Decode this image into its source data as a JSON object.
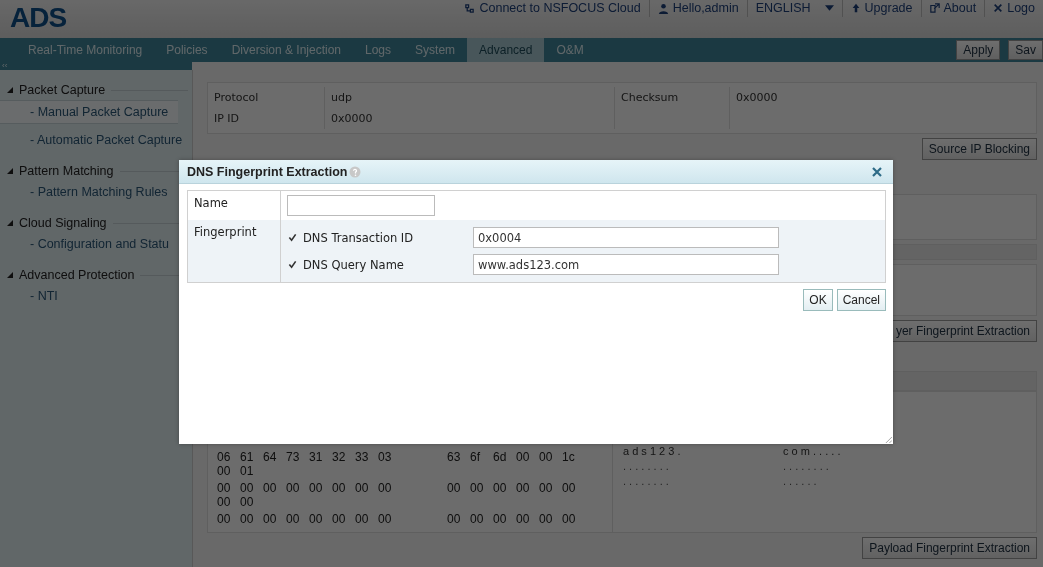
{
  "header": {
    "logo": "ADS",
    "links": [
      {
        "label": "Connect to NSFOCUS Cloud",
        "kind": "link"
      },
      {
        "label": "Hello,admin",
        "kind": "link"
      },
      {
        "label": "ENGLISH",
        "kind": "dropdown"
      },
      {
        "label": "Upgrade",
        "kind": "link"
      },
      {
        "label": "About",
        "kind": "link"
      },
      {
        "label": "Logo",
        "kind": "link"
      }
    ]
  },
  "nav": {
    "tabs": [
      {
        "label": "Real-Time Monitoring",
        "selected": false
      },
      {
        "label": "Policies",
        "selected": false
      },
      {
        "label": "Diversion & Injection",
        "selected": false
      },
      {
        "label": "Logs",
        "selected": false
      },
      {
        "label": "System",
        "selected": false
      },
      {
        "label": "Advanced",
        "selected": true
      },
      {
        "label": "O&M",
        "selected": false
      }
    ],
    "actions": [
      "Apply",
      "Sav"
    ]
  },
  "sidebar": {
    "collapse": "‹‹",
    "groups": [
      {
        "label": "Packet Capture",
        "expanded": true,
        "children": [
          {
            "label": "- Manual Packet Capture",
            "selected": true
          },
          {
            "label": "- Automatic Packet Capture",
            "selected": false
          }
        ]
      },
      {
        "label": "Pattern Matching",
        "expanded": true,
        "children": [
          {
            "label": "- Pattern Matching Rules",
            "selected": false
          }
        ]
      },
      {
        "label": "Cloud Signaling",
        "expanded": true,
        "children": [
          {
            "label": "- Configuration and Statu",
            "selected": false
          }
        ]
      },
      {
        "label": "Advanced Protection",
        "expanded": true,
        "children": [
          {
            "label": "- NTI",
            "selected": false
          }
        ]
      }
    ]
  },
  "content": {
    "packet_table": {
      "rows": [
        {
          "cells": [
            "Protocol",
            "udp",
            "Checksum",
            "0x0000"
          ]
        },
        {
          "cells": [
            "IP ID",
            "0x0000"
          ]
        }
      ]
    },
    "source_ip_button": "Source IP Blocking",
    "layer_button": "yer Fingerprint Extraction",
    "ascii_top": [
      "a d s 1 2 3 .",
      "c o m . . . . ."
    ],
    "hex_rows": [
      {
        "bytes": [
          "06",
          "61",
          "64",
          "73",
          "31",
          "32",
          "33",
          "03",
          "63",
          "6f",
          "6d",
          "00",
          "00",
          "1c",
          "00",
          "01"
        ]
      },
      {
        "bytes": [
          "00",
          "00",
          "00",
          "00",
          "00",
          "00",
          "00",
          "00",
          "00",
          "00",
          "00",
          "00",
          "00",
          "00",
          "00",
          "00"
        ]
      },
      {
        "bytes": [
          "00",
          "00",
          "00",
          "00",
          "00",
          "00",
          "00",
          "00",
          "00",
          "00",
          "00",
          "00",
          "00",
          "00"
        ]
      }
    ],
    "ascii_rows": [
      [
        ". . . . . . . .",
        ". . . . . . . ."
      ],
      [
        ". . . . . . . .",
        ". . . . . ."
      ]
    ],
    "payload_button": "Payload Fingerprint Extraction"
  },
  "dialog": {
    "title": "DNS Fingerprint Extraction",
    "name_label": "Name",
    "fingerprint_label": "Fingerprint",
    "options": [
      {
        "label": "DNS Transaction ID",
        "checked": true,
        "value": "0x0004"
      },
      {
        "label": "DNS Query Name",
        "checked": true,
        "value": "www.ads123.com"
      }
    ],
    "buttons": [
      "OK",
      "Cancel"
    ]
  }
}
